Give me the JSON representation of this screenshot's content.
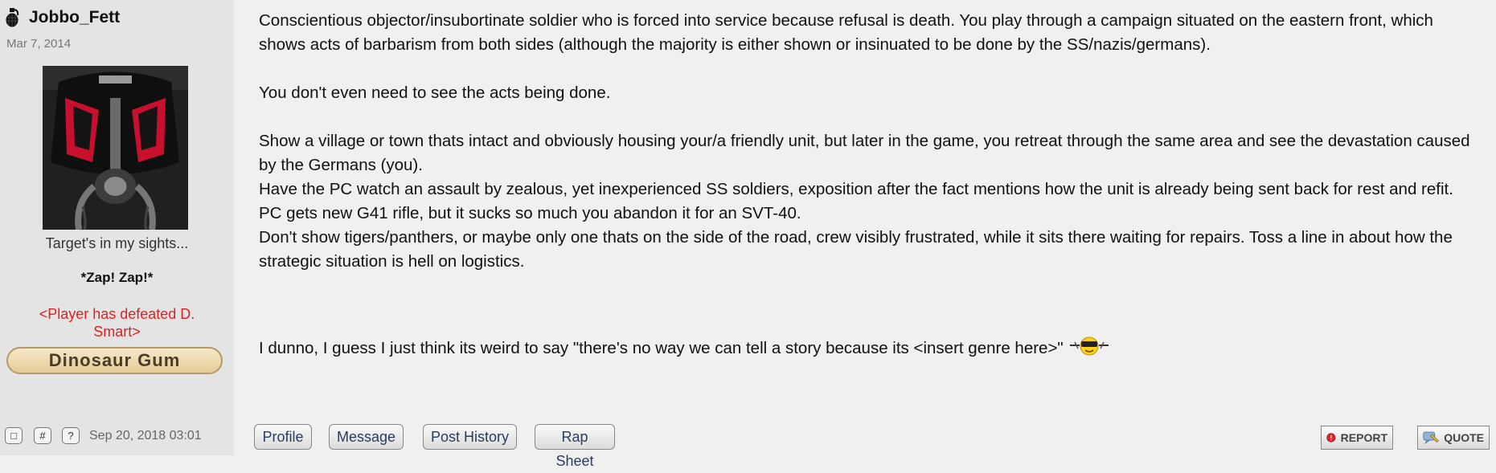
{
  "user": {
    "name": "Jobbo_Fett",
    "join_date": "Mar 7, 2014",
    "custom_title": "Target's in my sights...",
    "tagline": "*Zap! Zap!*",
    "status": "<Player has defeated D. Smart>",
    "badge": "Dinosaur Gum",
    "icon": "grenade-icon"
  },
  "post": {
    "timestamp": "Sep 20, 2018 03:01",
    "paragraphs": [
      "Conscientious objector/insubortinate soldier who is forced into service because refusal is death. You play through a campaign situated on the eastern front, which shows acts of barbarism from both sides (although the majority is either shown or insinuated to be done by the SS/nazis/germans).",
      "You don't even need to see the acts being done.",
      "Show a village or town thats intact and obviously housing your/a friendly unit, but later in the game, you retreat through the same area and see the devastation caused by the Germans (you).",
      "Have the PC watch an assault by zealous, yet inexperienced SS soldiers, exposition after the fact mentions how the unit is already being sent back for rest and refit.",
      "PC gets new G41 rifle, but it sucks so much you abandon it for an SVT-40.",
      "Don't show tigers/panthers, or maybe only one thats on the side of the road, crew visibly frustrated, while it sits there waiting for repairs. Toss a line in about how the strategic situation is hell on logistics.",
      "I dunno, I guess I just think its weird to say \"there's no way we can tell a story because its <insert genre here>\""
    ]
  },
  "footer": {
    "icon_buttons": [
      "□",
      "#",
      "?"
    ],
    "links": [
      "Profile",
      "Message",
      "Post History",
      "Rap Sheet"
    ],
    "report_label": "REPORT",
    "quote_label": "QUOTE"
  }
}
